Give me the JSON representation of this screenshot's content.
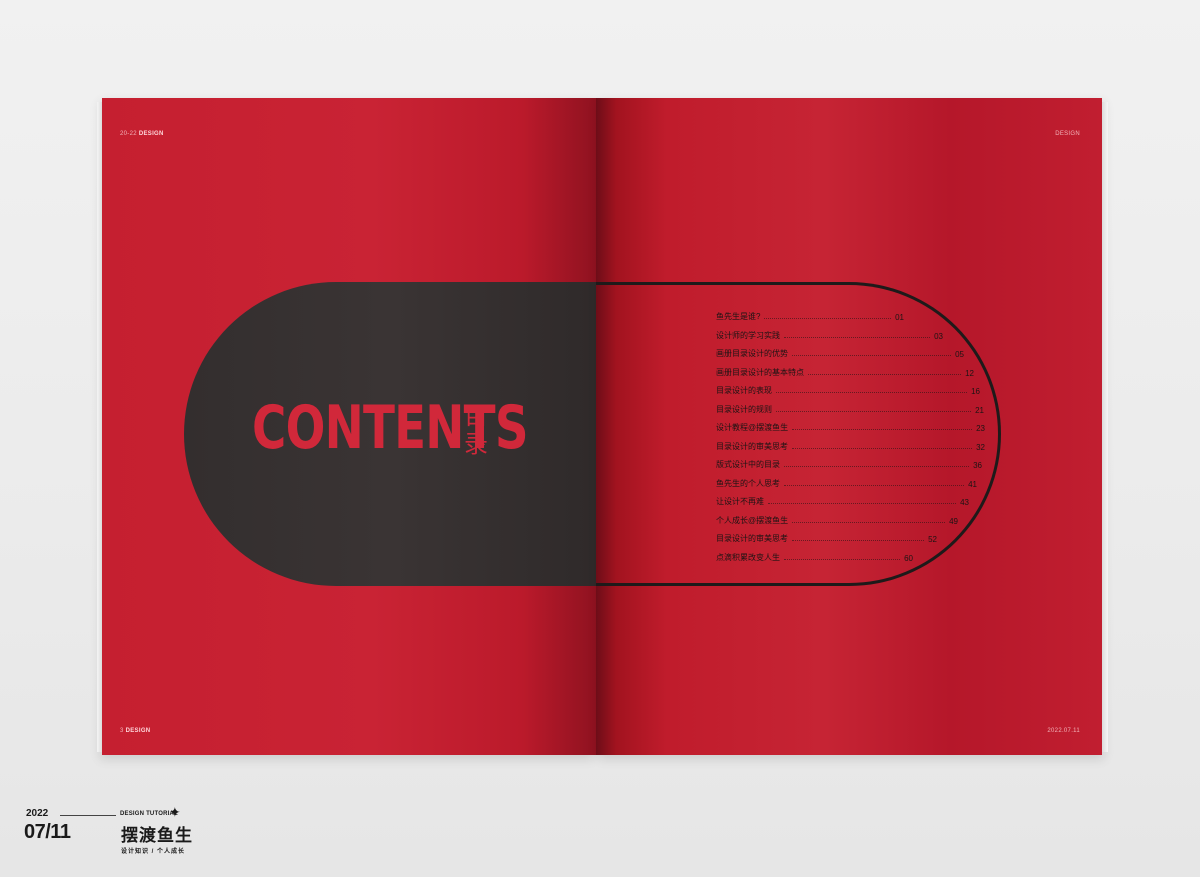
{
  "left_page": {
    "header_prefix": "20-22",
    "header_label": "DESIGN",
    "footer_prefix": "3",
    "footer_label": "DESIGN",
    "title_en": "CONTENTS",
    "title_cn": "目录"
  },
  "right_page": {
    "header_label": "DESIGN",
    "footer_label": "2022.07.11"
  },
  "toc": [
    {
      "label": "鱼先生是谁?",
      "page": "01"
    },
    {
      "label": "设计师的学习实践",
      "page": "03"
    },
    {
      "label": "画册目录设计的优势",
      "page": "05"
    },
    {
      "label": "画册目录设计的基本特点",
      "page": "12"
    },
    {
      "label": "目录设计的表现",
      "page": "16"
    },
    {
      "label": "目录设计的规则",
      "page": "21"
    },
    {
      "label": "设计教程@摆渡鱼生",
      "page": "23"
    },
    {
      "label": "目录设计的审美思考",
      "page": "32"
    },
    {
      "label": "版式设计中的目录",
      "page": "36"
    },
    {
      "label": "鱼先生的个人思考",
      "page": "41"
    },
    {
      "label": "让设计不再难",
      "page": "43"
    },
    {
      "label": "个人成长@摆渡鱼生",
      "page": "49"
    },
    {
      "label": "目录设计的审美思考",
      "page": "52"
    },
    {
      "label": "点滴积累改变人生",
      "page": "60"
    }
  ],
  "brand": {
    "year": "2022",
    "date": "07/11",
    "tutorial": "DESIGN TUTORIAL",
    "name": "摆渡鱼生",
    "subtitle": "设计知识 / 个人成长",
    "star_icon": "four-point-star-icon"
  },
  "colors": {
    "page_red": "#c62434",
    "pill_dark": "#363030",
    "title_red": "#d1283a"
  }
}
